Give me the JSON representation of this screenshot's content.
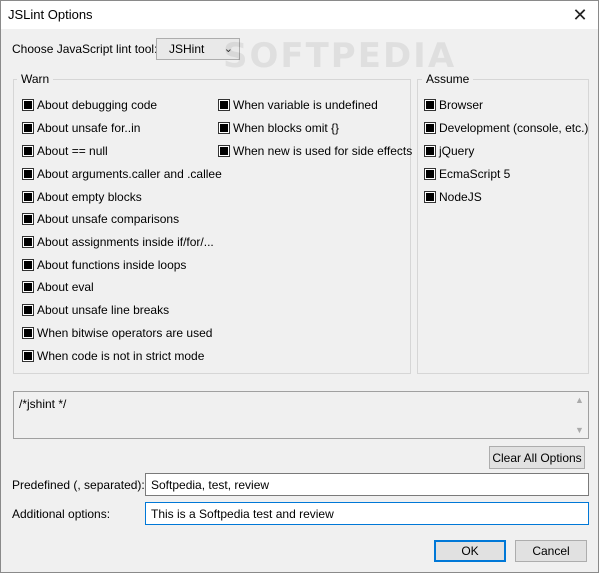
{
  "window": {
    "title": "JSLint Options",
    "close_glyph": "✕"
  },
  "lint_tool": {
    "label": "Choose JavaScript lint tool:",
    "selected": "JSHint"
  },
  "watermark": "SOFTPEDIA",
  "warn": {
    "label": "Warn",
    "col1": [
      "About debugging code",
      "About unsafe for..in",
      "About == null",
      "About arguments.caller and .callee",
      "About empty blocks",
      "About unsafe comparisons",
      "About assignments inside if/for/...",
      "About functions inside loops",
      "About eval",
      "About unsafe line breaks",
      "When bitwise operators are used",
      "When code is not in strict mode"
    ],
    "col2": [
      "When variable is undefined",
      "When blocks omit {}",
      "When new is used for side effects"
    ]
  },
  "assume": {
    "label": "Assume",
    "items": [
      "Browser",
      "Development (console, etc.)",
      "jQuery",
      "EcmaScript 5",
      "NodeJS"
    ]
  },
  "editor": {
    "text": "/*jshint  */"
  },
  "clear_all_label": "Clear All Options",
  "predefined": {
    "label": "Predefined (, separated):",
    "value": "Softpedia, test, review"
  },
  "additional": {
    "label": "Additional options:",
    "value": "This is a Softpedia test and review"
  },
  "ok_label": "OK",
  "cancel_label": "Cancel"
}
